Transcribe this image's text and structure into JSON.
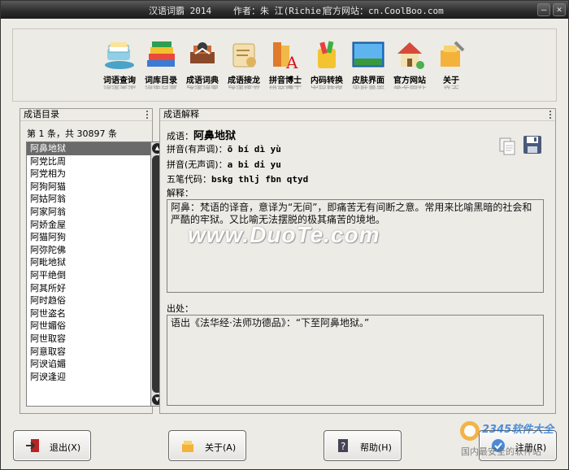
{
  "titlebar": {
    "app_title": "汉语词霸 2014",
    "author": "作者：朱 江(Richie)",
    "website": "官方网站：cn.CoolBoo.com",
    "minimize": "—",
    "close": "✕"
  },
  "toolbar": {
    "items": [
      {
        "label": "词语查询",
        "icon": "books-icon"
      },
      {
        "label": "词库目录",
        "icon": "book-stack-icon"
      },
      {
        "label": "成语词典",
        "icon": "dictionary-icon"
      },
      {
        "label": "成语接龙",
        "icon": "scroll-icon"
      },
      {
        "label": "拼音博士",
        "icon": "pinyin-icon"
      },
      {
        "label": "内码转换",
        "icon": "convert-icon"
      },
      {
        "label": "皮肤界面",
        "icon": "skin-icon"
      },
      {
        "label": "官方网站",
        "icon": "house-icon"
      },
      {
        "label": "关于",
        "icon": "about-icon"
      }
    ]
  },
  "idiom_list": {
    "header": "成语目录",
    "count": "第 1 条，共 30897 条",
    "items": [
      "阿鼻地狱",
      "阿党比周",
      "阿党相为",
      "阿狗阿猫",
      "阿姑阿翁",
      "阿家阿翁",
      "阿娇金屋",
      "阿猫阿狗",
      "阿弥陀佛",
      "阿毗地狱",
      "阿平绝倒",
      "阿其所好",
      "阿时趋俗",
      "阿世盗名",
      "阿世媚俗",
      "阿世取容",
      "阿意取容",
      "阿谀谄媚",
      "阿谀逢迎"
    ],
    "selected_index": 0
  },
  "detail": {
    "header": "成语解释",
    "idiom_label": "成语：",
    "idiom": "阿鼻地狱",
    "pinyin_tone_label": "拼音(有声调)：",
    "pinyin_tone": "ō bí dì yù",
    "pinyin_plain_label": "拼音(无声调)：",
    "pinyin_plain": "a bi di yu",
    "wubi_label": "五笔代码：",
    "wubi": "bskg thlj fbn qtyd",
    "explain_label": "解释：",
    "explanation": "阿鼻：梵语的译音，意译为“无间”，即痛苦无有间断之意。常用来比喻黑暗的社会和严酷的牢狱。又比喻无法摆脱的极其痛苦的境地。",
    "source_label": "出处：",
    "source": "语出《法华经·法师功德品》：“下至阿鼻地狱。”"
  },
  "watermark": "www.DuoTe.com",
  "buttons": {
    "exit": "退出(X)",
    "about": "关于(A)",
    "help": "帮助(H)",
    "register": "注册(R)"
  },
  "corner_watermark": {
    "brand": "2345软件大全",
    "tagline": "国内最安全的软件站"
  },
  "colors": {
    "titlebar": "#2b2b2b",
    "selection": "#6a6a6a",
    "background": "#ecebe6"
  }
}
